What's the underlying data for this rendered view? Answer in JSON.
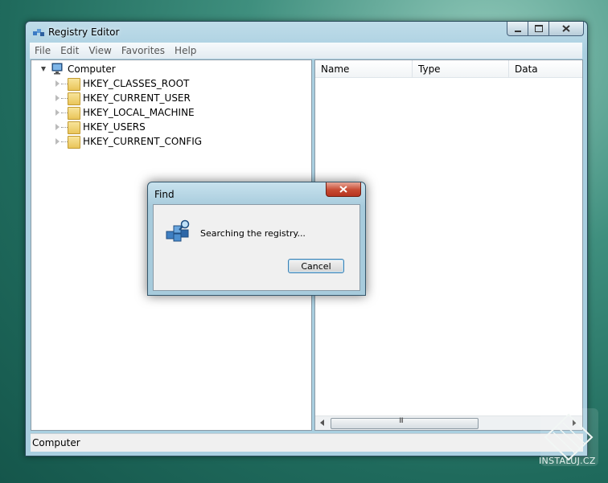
{
  "window": {
    "title": "Registry Editor",
    "menu": [
      "File",
      "Edit",
      "View",
      "Favorites",
      "Help"
    ]
  },
  "tree": {
    "root": "Computer",
    "children": [
      "HKEY_CLASSES_ROOT",
      "HKEY_CURRENT_USER",
      "HKEY_LOCAL_MACHINE",
      "HKEY_USERS",
      "HKEY_CURRENT_CONFIG"
    ]
  },
  "list": {
    "columns": [
      "Name",
      "Type",
      "Data"
    ],
    "scroll_grip": "III"
  },
  "status": {
    "text": "Computer"
  },
  "dialog": {
    "title": "Find",
    "message": "Searching the registry...",
    "cancel_label": "Cancel"
  },
  "watermark": {
    "text": "INSTALUJ.CZ"
  },
  "icons": {
    "app": "registry-editor-icon",
    "root": "computer-icon",
    "folder": "folder-icon",
    "search": "registry-search-icon"
  },
  "colors": {
    "desktop": "#1f6a5c",
    "frame": "#a9cfe0",
    "close": "#c74a32"
  }
}
